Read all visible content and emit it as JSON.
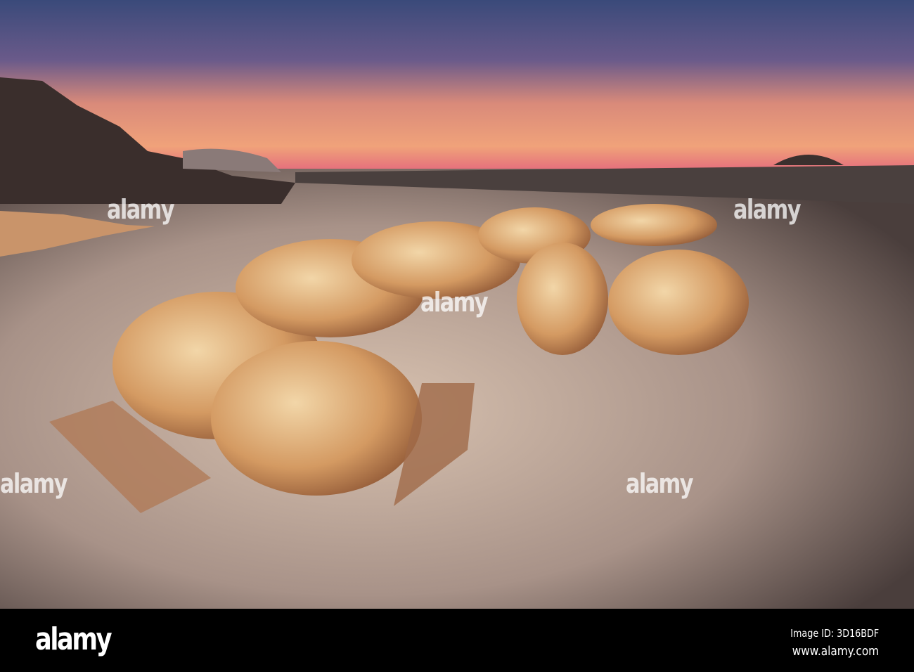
{
  "watermark": {
    "logo_text": "alamy"
  },
  "footer": {
    "logo": "alamy",
    "image_id": "Image ID: 3D16BDF",
    "url": "www.alamy.com"
  }
}
